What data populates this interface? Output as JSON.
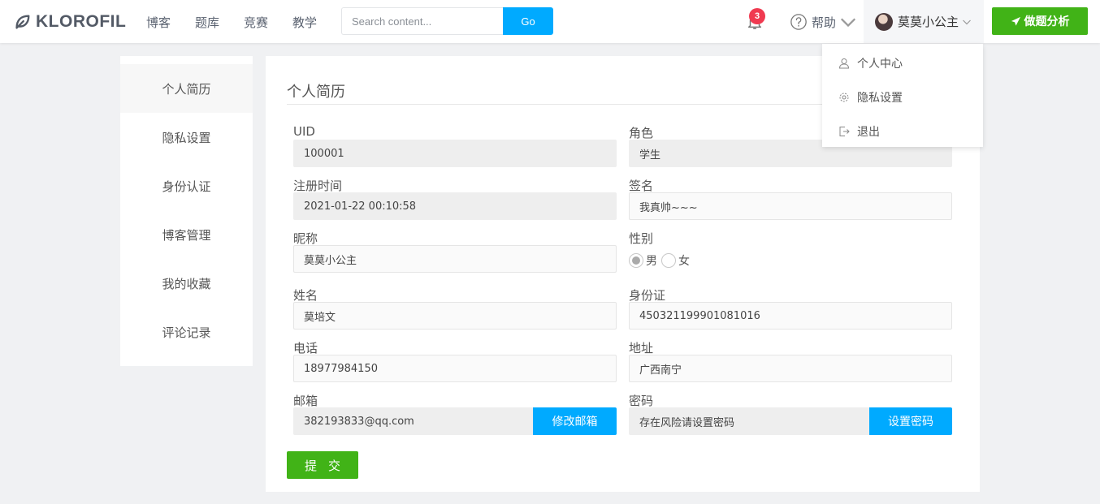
{
  "brand": {
    "name": "KLOROFIL"
  },
  "nav": [
    "博客",
    "题库",
    "竞赛",
    "教学"
  ],
  "search": {
    "placeholder": "Search content...",
    "button": "Go"
  },
  "notifications": {
    "count": "3"
  },
  "help": {
    "label": "帮助"
  },
  "user": {
    "name": "莫莫小公主"
  },
  "action_button": {
    "label": "做题分析"
  },
  "user_dropdown": [
    "个人中心",
    "隐私设置",
    "退出"
  ],
  "sidebar": [
    "个人简历",
    "隐私设置",
    "身份认证",
    "博客管理",
    "我的收藏",
    "评论记录"
  ],
  "panel": {
    "title": "个人简历",
    "submit": "提交"
  },
  "form": {
    "uid": {
      "label": "UID",
      "value": "100001"
    },
    "role": {
      "label": "角色",
      "value": "学生"
    },
    "register_time": {
      "label": "注册时间",
      "value": "2021-01-22 00:10:58"
    },
    "signature": {
      "label": "签名",
      "value": "我真帅~~~"
    },
    "nickname": {
      "label": "昵称",
      "value": "莫莫小公主"
    },
    "gender": {
      "label": "性别",
      "options": [
        "男",
        "女"
      ],
      "selected": "男"
    },
    "name": {
      "label": "姓名",
      "value": "莫培文"
    },
    "id_card": {
      "label": "身份证",
      "value": "450321199901081016"
    },
    "phone": {
      "label": "电话",
      "value": "18977984150"
    },
    "address": {
      "label": "地址",
      "value": "广西南宁"
    },
    "email": {
      "label": "邮箱",
      "value": "382193833@qq.com",
      "button": "修改邮箱"
    },
    "password": {
      "label": "密码",
      "value": "存在风险请设置密码",
      "button": "设置密码"
    }
  },
  "colors": {
    "primary": "#00aaff",
    "success": "#41b317",
    "badge": "#f03a50"
  }
}
